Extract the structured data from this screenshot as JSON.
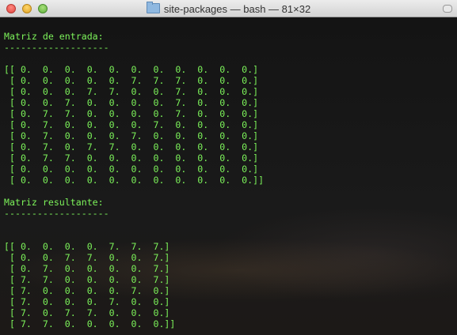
{
  "window": {
    "title": "site-packages — bash — 81×32",
    "icon": "folder-icon"
  },
  "terminal": {
    "lines": [
      "Matriz de entrada:",
      "-------------------",
      "",
      "[[ 0.  0.  0.  0.  0.  0.  0.  0.  0.  0.  0.]",
      " [ 0.  0.  0.  0.  0.  7.  7.  7.  0.  0.  0.]",
      " [ 0.  0.  0.  7.  7.  0.  0.  7.  0.  0.  0.]",
      " [ 0.  0.  7.  0.  0.  0.  0.  7.  0.  0.  0.]",
      " [ 0.  7.  7.  0.  0.  0.  0.  7.  0.  0.  0.]",
      " [ 0.  7.  0.  0.  0.  0.  7.  0.  0.  0.  0.]",
      " [ 0.  7.  0.  0.  0.  7.  0.  0.  0.  0.  0.]",
      " [ 0.  7.  0.  7.  7.  0.  0.  0.  0.  0.  0.]",
      " [ 0.  7.  7.  0.  0.  0.  0.  0.  0.  0.  0.]",
      " [ 0.  0.  0.  0.  0.  0.  0.  0.  0.  0.  0.]",
      " [ 0.  0.  0.  0.  0.  0.  0.  0.  0.  0.  0.]]",
      "",
      "Matriz resultante:",
      "-------------------",
      "",
      "",
      "[[ 0.  0.  0.  0.  7.  7.  7.]",
      " [ 0.  0.  7.  7.  0.  0.  7.]",
      " [ 0.  7.  0.  0.  0.  0.  7.]",
      " [ 7.  7.  0.  0.  0.  0.  7.]",
      " [ 7.  0.  0.  0.  0.  7.  0.]",
      " [ 7.  0.  0.  0.  7.  0.  0.]",
      " [ 7.  0.  7.  7.  0.  0.  0.]",
      " [ 7.  7.  0.  0.  0.  0.  0.]]"
    ],
    "text_color": "#7cf25a"
  }
}
